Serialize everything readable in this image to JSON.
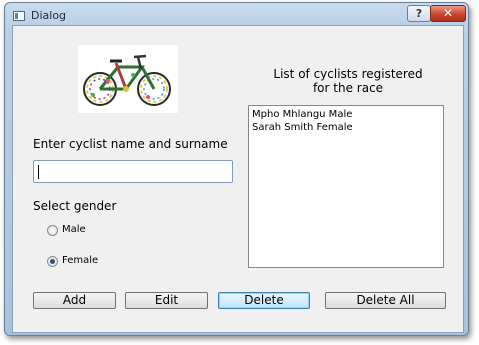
{
  "window": {
    "title": "Dialog",
    "help_label": "?",
    "close_label": "✕"
  },
  "form": {
    "name_prompt": "Enter cyclist name and surname",
    "name_value": "",
    "gender_prompt": "Select gender",
    "gender_options": [
      {
        "label": "Male",
        "checked": false
      },
      {
        "label": "Female",
        "checked": true
      }
    ]
  },
  "list": {
    "title_line1": "List of cyclists registered",
    "title_line2": "for the race",
    "items": [
      "Mpho Mhlangu Male",
      "Sarah Smith Female"
    ]
  },
  "buttons": {
    "add": "Add",
    "edit": "Edit",
    "delete": "Delete",
    "delete_all": "Delete All"
  },
  "colors": {
    "accent": "#3c7fb1",
    "client_bg": "#f0f0f0",
    "titlebar": "#b8cfe6",
    "close": "#c74530"
  }
}
